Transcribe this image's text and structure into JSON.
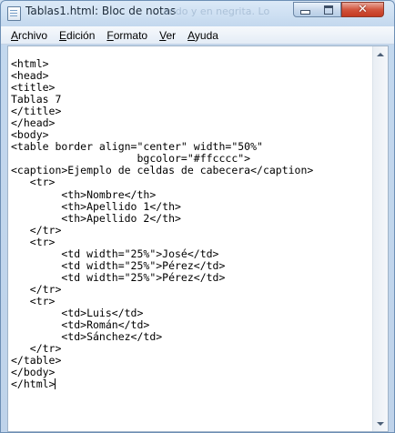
{
  "window": {
    "title": "Tablas1.html: Bloc de notas",
    "background_hint": "ando y en negrita. Lo"
  },
  "menu": [
    {
      "key": "archivo",
      "ul": "A",
      "rest": "rchivo"
    },
    {
      "key": "edicion",
      "ul": "E",
      "rest": "dición"
    },
    {
      "key": "formato",
      "ul": "F",
      "rest": "ormato"
    },
    {
      "key": "ver",
      "ul": "V",
      "rest": "er"
    },
    {
      "key": "ayuda",
      "ul": "A",
      "rest": "yuda"
    }
  ],
  "document": {
    "lines": [
      "<html>",
      "<head>",
      "<title>",
      "Tablas 7",
      "</title>",
      "</head>",
      "<body>",
      "<table border align=\"center\" width=\"50%\"",
      "                    bgcolor=\"#ffcccc\">",
      "<caption>Ejemplo de celdas de cabecera</caption>",
      "   <tr>",
      "        <th>Nombre</th>",
      "        <th>Apellido 1</th>",
      "        <th>Apellido 2</th>",
      "   </tr>",
      "   <tr>",
      "        <td width=\"25%\">José</td>",
      "        <td width=\"25%\">Pérez</td>",
      "        <td width=\"25%\">Pérez</td>",
      "   </tr>",
      "   <tr>",
      "        <td>Luis</td>",
      "        <td>Román</td>",
      "        <td>Sánchez</td>",
      "   </tr>",
      "</table>",
      "</body>",
      "</html>"
    ]
  },
  "colors": {
    "titlebar": "#c3d8ee",
    "close_button": "#c43a21",
    "editor_bg": "#ffffff"
  }
}
